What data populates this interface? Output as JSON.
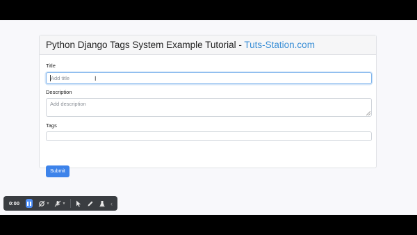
{
  "card": {
    "title": "Python Django Tags System Example Tutorial - ",
    "title_brand": "Tuts-Station.com"
  },
  "form": {
    "title_label": "Title",
    "title_placeholder": "Add title",
    "description_label": "Description",
    "description_placeholder": "Add description",
    "tags_label": "Tags",
    "tags_value": "",
    "submit_label": "Submit"
  },
  "recorder": {
    "time": "0:00",
    "icons": [
      "pause-icon",
      "webcam-off-icon",
      "mic-off-icon",
      "pointer-icon",
      "pen-icon",
      "highlighter-icon",
      "collapse-icon"
    ]
  },
  "colors": {
    "brand": "#3b8fd6",
    "submit": "#3d83ea",
    "toolbar": "#3a3d41",
    "pause": "#4f8ff7"
  }
}
